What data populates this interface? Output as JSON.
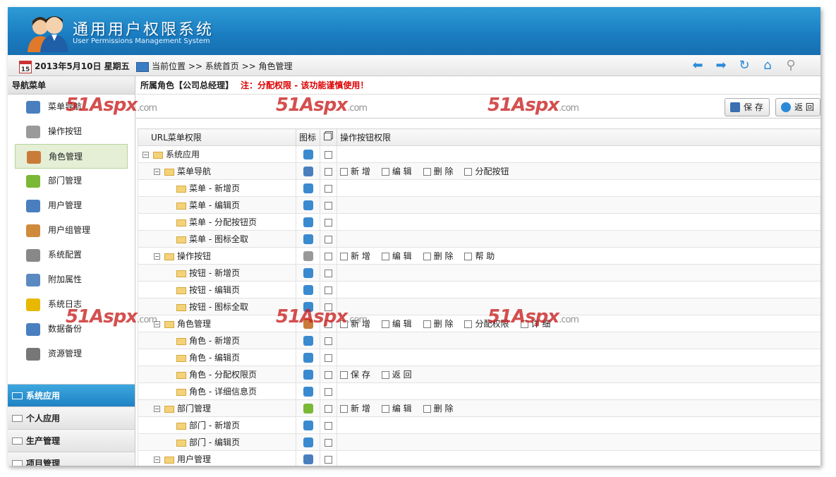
{
  "app": {
    "title": "通用用户权限系统",
    "subtitle": "User Permissions Management System"
  },
  "toolbar": {
    "calendar_day": "15",
    "date": "2013年5月10日 星期五",
    "location_label": "当前位置",
    "breadcrumb": ">> 系统首页 >> 角色管理",
    "icons": [
      "back-arrow-icon",
      "forward-arrow-icon",
      "refresh-icon",
      "home-icon",
      "search-icon"
    ]
  },
  "sidebar": {
    "header": "导航菜单",
    "items": [
      {
        "label": "菜单导航",
        "icon": "sitemap-icon",
        "color": "#4a7fbf"
      },
      {
        "label": "操作按钮",
        "icon": "wrench-icon",
        "color": "#9a9a9a"
      },
      {
        "label": "角色管理",
        "icon": "users-icon",
        "color": "#c97b3a",
        "active": true
      },
      {
        "label": "部门管理",
        "icon": "branch-arrow-icon",
        "color": "#7ab836"
      },
      {
        "label": "用户管理",
        "icon": "user-card-icon",
        "color": "#4a7fbf"
      },
      {
        "label": "用户组管理",
        "icon": "user-group-icon",
        "color": "#d08a3c"
      },
      {
        "label": "系统配置",
        "icon": "tools-icon",
        "color": "#888888"
      },
      {
        "label": "附加属性",
        "icon": "book-icon",
        "color": "#5a8ac0"
      },
      {
        "label": "系统日志",
        "icon": "warning-icon",
        "color": "#e8b800"
      },
      {
        "label": "数据备份",
        "icon": "document-icon",
        "color": "#4a7fbf"
      },
      {
        "label": "资源管理",
        "icon": "server-icon",
        "color": "#777777"
      }
    ],
    "accordion": [
      {
        "label": "系统应用",
        "selected": true
      },
      {
        "label": "个人应用"
      },
      {
        "label": "生产管理"
      },
      {
        "label": "项目管理"
      }
    ]
  },
  "main": {
    "role_label": "所属角色【公司总经理】",
    "warning": "注：分配权限 - 该功能谨慎使用！",
    "save_label": "保 存",
    "back_label": "返 回",
    "table_headers": {
      "menu": "URL菜单权限",
      "icon": "图标",
      "check_icon": "copy-icon",
      "ops": "操作按钮权限"
    }
  },
  "rows": [
    {
      "level": 0,
      "label": "系统应用",
      "toggle": "⊟",
      "icon": "link-icon",
      "ops": []
    },
    {
      "level": 1,
      "label": "菜单导航",
      "toggle": "⊟",
      "icon": "sitemap-icon",
      "ops": [
        "新 增",
        "编 辑",
        "删 除",
        "分配按钮"
      ]
    },
    {
      "level": 2,
      "label": "菜单 - 新增页",
      "icon": "link-icon",
      "ops": []
    },
    {
      "level": 2,
      "label": "菜单 - 编辑页",
      "icon": "link-icon",
      "ops": []
    },
    {
      "level": 2,
      "label": "菜单 - 分配按钮页",
      "icon": "link-icon",
      "ops": []
    },
    {
      "level": 2,
      "label": "菜单 - 图标全取",
      "icon": "link-icon",
      "ops": []
    },
    {
      "level": 1,
      "label": "操作按钮",
      "toggle": "⊟",
      "icon": "wrench-icon",
      "ops": [
        "新 增",
        "编 辑",
        "删 除",
        "帮 助"
      ]
    },
    {
      "level": 2,
      "label": "按钮 - 新增页",
      "icon": "link-icon",
      "ops": []
    },
    {
      "level": 2,
      "label": "按钮 - 编辑页",
      "icon": "link-icon",
      "ops": []
    },
    {
      "level": 2,
      "label": "按钮 - 图标全取",
      "icon": "link-icon",
      "ops": []
    },
    {
      "level": 1,
      "label": "角色管理",
      "toggle": "⊟",
      "icon": "users-icon",
      "ops": [
        "新 增",
        "编 辑",
        "删 除",
        "分配权限",
        "详 细"
      ]
    },
    {
      "level": 2,
      "label": "角色 - 新增页",
      "icon": "link-icon",
      "ops": []
    },
    {
      "level": 2,
      "label": "角色 - 编辑页",
      "icon": "link-icon",
      "ops": []
    },
    {
      "level": 2,
      "label": "角色 - 分配权限页",
      "icon": "link-icon",
      "ops": [
        "保 存",
        "返 回"
      ]
    },
    {
      "level": 2,
      "label": "角色 - 详细信息页",
      "icon": "link-icon",
      "ops": []
    },
    {
      "level": 1,
      "label": "部门管理",
      "toggle": "⊟",
      "icon": "branch-arrow-icon",
      "ops": [
        "新 增",
        "编 辑",
        "删 除"
      ]
    },
    {
      "level": 2,
      "label": "部门 - 新增页",
      "icon": "link-icon",
      "ops": []
    },
    {
      "level": 2,
      "label": "部门 - 编辑页",
      "icon": "link-icon",
      "ops": []
    },
    {
      "level": 1,
      "label": "用户管理",
      "toggle": "⊟",
      "icon": "user-card-icon",
      "ops": []
    }
  ],
  "watermark": {
    "brand": "51Aspx",
    "suffix": ".com"
  }
}
